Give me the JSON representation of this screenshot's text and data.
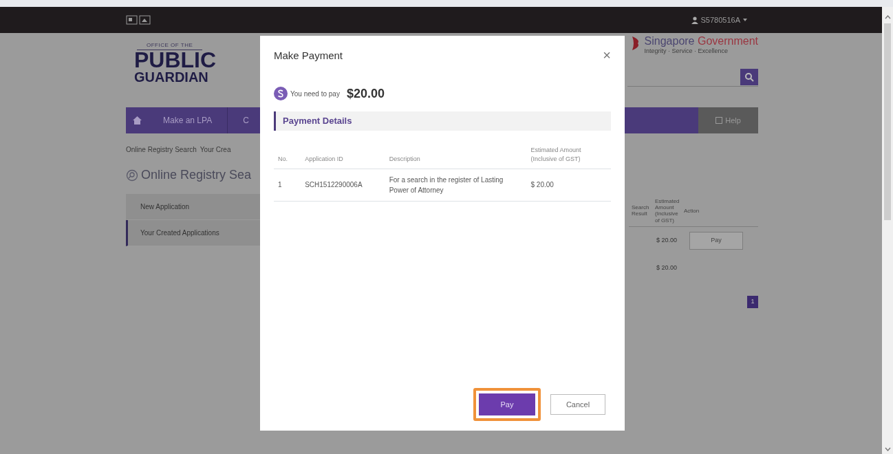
{
  "top_bar": {
    "user": "S5780516A"
  },
  "logo": {
    "line1": "OFFICE OF THE",
    "line2": "PUBLIC",
    "line3": "GUARDIAN"
  },
  "gov_logo": {
    "name": "Singapore",
    "name_accent": "Government",
    "tagline": "Integrity · Service · Excellence"
  },
  "nav": {
    "items": [
      {
        "label": "Make an LPA"
      },
      {
        "label": "C"
      }
    ],
    "help": "Help"
  },
  "breadcrumb": [
    "Online Registry Search",
    "Your Crea"
  ],
  "page_title": "Online Registry Sea",
  "side_menu": [
    {
      "label": "New Application",
      "selected": false
    },
    {
      "label": "Your Created Applications",
      "selected": true
    }
  ],
  "background_table": {
    "columns": [
      "Search Result",
      "Estimated Amount (Inclusive of GST)",
      "Action"
    ],
    "rows": [
      {
        "amount": "$ 20.00",
        "action": "Pay"
      }
    ],
    "total": "$ 20.00",
    "pagination": [
      {
        "label": "1",
        "selected": true
      }
    ]
  },
  "modal": {
    "title": "Make Payment",
    "close": "×",
    "amount_prompt": "You need to pay",
    "amount": "$20.00",
    "section": "Payment Details",
    "columns": [
      "No.",
      "Application ID",
      "Description",
      "Estimated Amount (Inclusive of GST)"
    ],
    "rows": [
      {
        "no": "1",
        "application_id": "SCH1512290006A",
        "description": "For a search in the register of Lasting Power of Attorney",
        "amount": "$ 20.00"
      }
    ],
    "buttons": [
      {
        "label": "Pay",
        "kind": "primary",
        "highlighted": true
      },
      {
        "label": "Cancel",
        "kind": "secondary",
        "highlighted": false
      }
    ]
  }
}
